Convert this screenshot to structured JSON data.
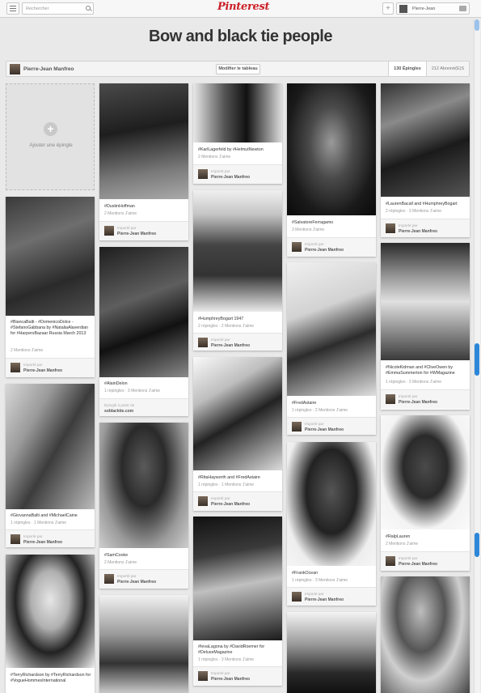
{
  "header": {
    "search_placeholder": "Rechercher",
    "logo": "Pinterest",
    "add_label": "+",
    "user_name": "Pierre-Jean"
  },
  "board": {
    "title": "Bow and black tie people",
    "owner": "Pierre-Jean Manfreo",
    "edit_label": "Modifier le tableau",
    "pins_tab": "130 Épingles",
    "followers_tab": "212 Abonné(E)S"
  },
  "add_pin_label": "Ajouter une épingle",
  "credit_label": "Importé par",
  "source_label": "Épinglé à partir de",
  "pins": [
    {
      "caption": "#DustinHoffman",
      "stats": "2 Mentions J'aime",
      "credit": "Pierre-Jean Manfreo"
    },
    {
      "caption": "#AlainDelon",
      "stats": "1 répingles · 3 Mentions J'aime",
      "source": "soblacktie.com"
    },
    {
      "caption": "#SamCooke",
      "stats": "2 Mentions J'aime",
      "credit": "Pierre-Jean Manfreo"
    },
    {
      "caption": "#KarlLagerfeld by #HelmutNewton",
      "stats": "2 Mentions J'aime",
      "credit": "Pierre-Jean Manfreo"
    },
    {
      "caption": "#HumphreyBogart 1947",
      "stats": "2 répingles · 2 Mentions J'aime",
      "credit": "Pierre-Jean Manfreo"
    },
    {
      "caption": "#RitaHayworth and #FredAstaire",
      "stats": "1 répingles · 1 Mentions J'aime",
      "credit": "Pierre-Jean Manfreo"
    },
    {
      "caption": "#IevaLagona by #DavidRoemer for #DeluxeMagazine",
      "stats": "1 répingles · 3 Mentions J'aime",
      "credit": "Pierre-Jean Manfreo"
    },
    {
      "caption": "#SalvatoreFerragamo",
      "stats": "3 Mentions J'aime",
      "credit": "Pierre-Jean Manfreo"
    },
    {
      "caption": "#FredAstaire",
      "stats": "1 répingles · 2 Mentions J'aime",
      "credit": "Pierre-Jean Manfreo"
    },
    {
      "caption": "#FrankOcean",
      "stats": "1 répingles · 3 Mentions J'aime",
      "credit": "Pierre-Jean Manfreo"
    },
    {
      "caption": "#LaurenBacall and #HumphreyBogart",
      "stats": "2 répingles · 3 Mentions J'aime",
      "credit": "Pierre-Jean Manfreo"
    },
    {
      "caption": "#NicoleKidman and #CliveOwen by #EmmaSummerton for #WMagazine",
      "stats": "1 répingles · 3 Mentions J'aime",
      "credit": "Pierre-Jean Manfreo"
    },
    {
      "caption": "#RalpLauren",
      "stats": "2 Mentions J'aime",
      "credit": "Pierre-Jean Manfreo"
    },
    {
      "caption": "#BiancaBalti - #DomenicoDolce - #StefanoGabbana by #NataliaAlaverdian for #HarpersBazaar Russia March 2013",
      "stats": "2 Mentions J'aime",
      "credit": "Pierre-Jean Manfreo"
    },
    {
      "caption": "#GiovannaBalti and #MichaelCaine",
      "stats": "1 répingles · 1 Mentions J'aime",
      "credit": "Pierre-Jean Manfreo"
    },
    {
      "caption": "#TerryRichardson by #TerryRichardson for #VogueHommesInternational",
      "stats": "",
      "credit": ""
    }
  ]
}
